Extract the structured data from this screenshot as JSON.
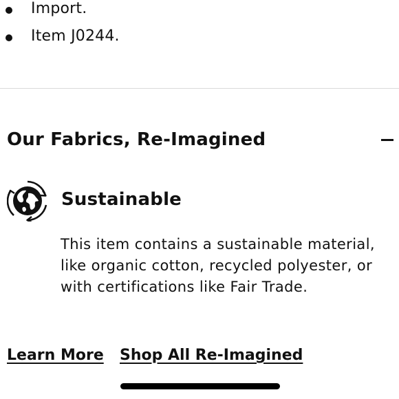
{
  "bullets": [
    {
      "text": "Import."
    },
    {
      "text": "Item J0244."
    }
  ],
  "section": {
    "title": "Our Fabrics, Re-Imagined",
    "toggle_icon": "minus-icon",
    "expanded": true
  },
  "feature": {
    "icon": "globe-recycle-icon",
    "title": "Sustainable",
    "description": "This item contains a sustainable material, like organic cotton, recycled polyester, or with certifications like Fair Trade."
  },
  "links": {
    "learn_more": "Learn More",
    "shop_all": "Shop All Re-Imagined"
  }
}
